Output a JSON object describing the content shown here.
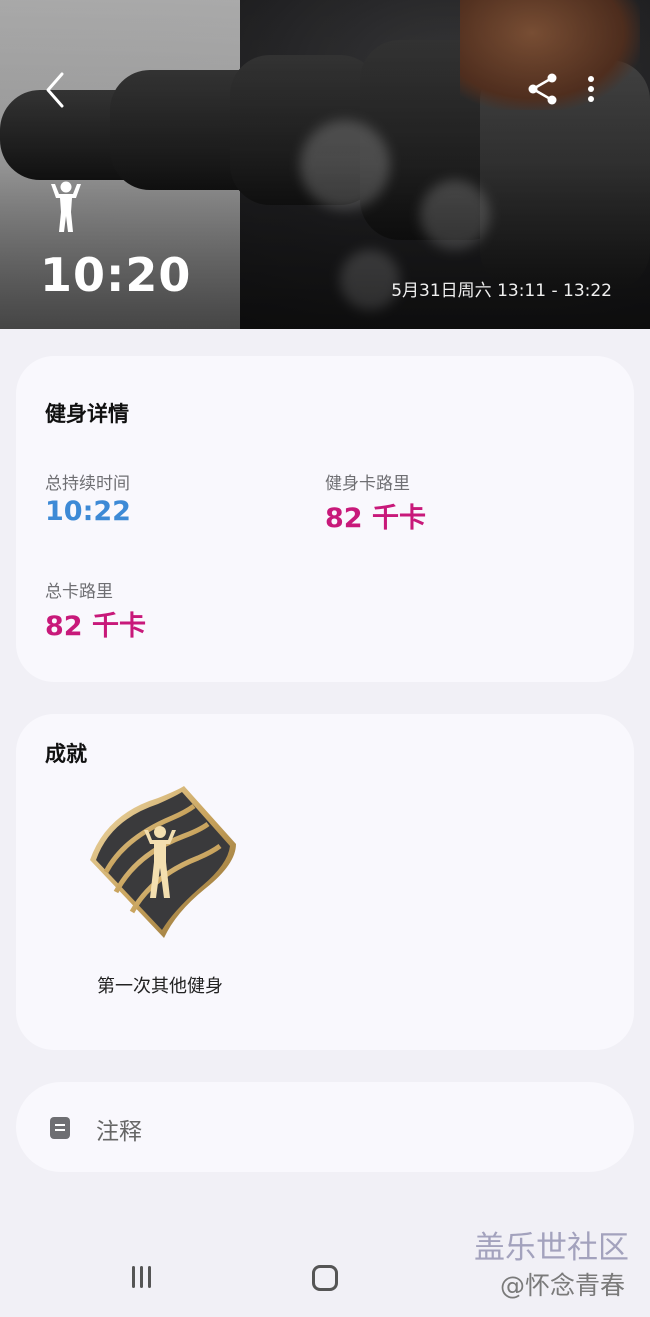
{
  "header": {
    "duration": "10:20",
    "date_range": "5月31日周六 13:11 - 13:22"
  },
  "icons": {
    "back": "chevron-left-icon",
    "share": "share-icon",
    "more": "more-vert-icon",
    "workout": "workout-person-icon",
    "note": "note-icon"
  },
  "details": {
    "title": "健身详情",
    "total_duration_label": "总持续时间",
    "total_duration_value": "10:22",
    "workout_cal_label": "健身卡路里",
    "workout_cal_value": "82 千卡",
    "total_cal_label": "总卡路里",
    "total_cal_value": "82 千卡"
  },
  "achievements": {
    "title": "成就",
    "badge_label": "第一次其他健身"
  },
  "note": {
    "label": "注释"
  },
  "watermark": {
    "line1": "盖乐世社区",
    "line2": "@怀念青春"
  },
  "colors": {
    "duration_blue": "#3d8ad6",
    "calorie_pink": "#c8197a",
    "card_bg": "#f9f8fd",
    "page_bg": "#f1f0f6"
  }
}
